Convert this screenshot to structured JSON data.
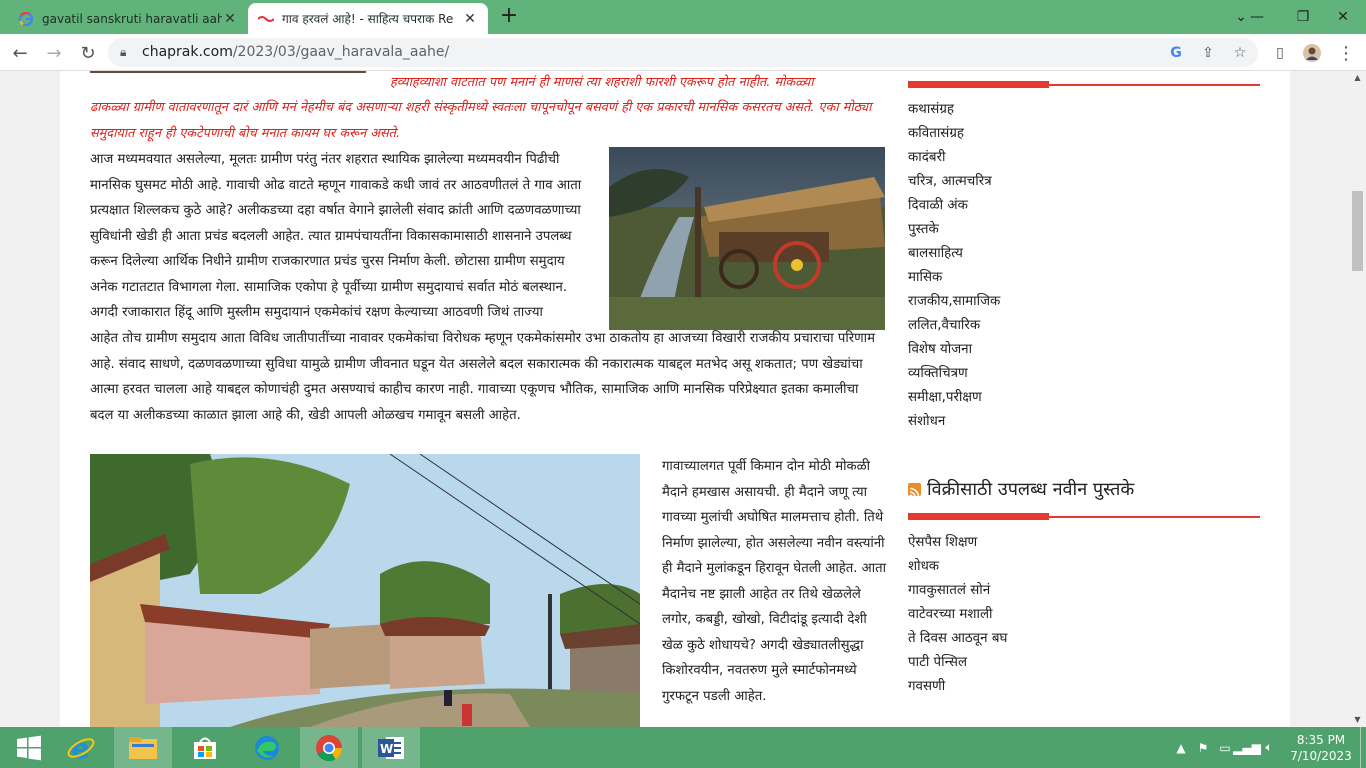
{
  "browser": {
    "tabs": [
      {
        "title": "gavatil sanskruti haravatli aahe in",
        "icon": "google-icon"
      },
      {
        "title": "गाव हरवलं आहे! - साहित्य चपराक Re",
        "icon": "chaprak-icon"
      }
    ],
    "url_domain": "chaprak.com",
    "url_path": "/2023/03/gaav_haravala_aahe/"
  },
  "article": {
    "quote_line1": "हव्याहव्याशा वाटतात पण मनानं ही माणसं त्या शहराशी फारशी एकरूप होत नाहीत. मोकळ्या",
    "quote_line2": "ढाकळ्या ग्रामीण वातावरणातून दारं आणि मनं नेहमीच बंद असणाऱ्या शहरी संस्कृतीमध्ये स्वतःला चापूनचोपून बसवणं ही एक प्रकारची मानसिक कसरतच असते. एका मोठ्या समुदायात राहून ही एकटेपणाची बोच मनात कायम घर करून असते.",
    "para1": "आज मध्यमवयात असलेल्या, मूलतः ग्रामीण परंतु नंतर शहरात स्थायिक झालेल्या मध्यमवयीन पिढीची मानसिक घुसमट मोठी आहे. गावाची ओढ वाटते म्हणून गावाकडे कधी जावं तर आठवणीतलं ते गाव आता प्रत्यक्षात शिल्लकच कुठे आहे? अलीकडच्या दहा वर्षात वेगाने झालेली संवाद क्रांती आणि दळणवळणाच्या सुविधांनी खेडी ही आता प्रचंड बदलली आहेत. त्यात ग्रामपंचायतींना विकासकामासाठी शासनाने उपलब्ध करून दिलेल्या आर्थिक निधीने ग्रामीण राजकारणात प्रचंड चुरस निर्माण केली. छोटासा ग्रामीण समुदाय अनेक गटातटात विभागला गेला. सामाजिक एकोपा हे पूर्वीच्या ग्रामीण समुदायाचं सर्वात मोठं बलस्थान. अगदी रजाकारात हिंदू आणि मुस्लीम समुदायानं एकमेकांचं रक्षण केल्याच्या आठवणी जिथं ताज्या",
    "para1b": "आहेत तोच ग्रामीण समुदाय आता विविध जातीपातींच्या नावावर एकमेकांचा विरोधक म्हणून एकमेकांसमोर उभा ठाकतोय हा आजच्या विखारी राजकीय प्रचाराचा परिणाम आहे. संवाद साधणे, दळणवळणाच्या सुविधा यामुळे ग्रामीण जीवनात घडून येत असलेले बदल सकारात्मक की नकारात्मक याबद्दल मतभेद असू शकतात; पण खेड्यांचा आत्मा हरवत चालला आहे याबद्दल कोणाचंही दुमत असण्याचं काहीच कारण नाही. गावाच्या एकूणच भौतिक, सामाजिक आणि मानसिक परिप्रेक्ष्यात इतका कमालीचा बदल या अलीकडच्या काळात झाला आहे की, खेडी आपली ओळखच गमावून बसली आहेत.",
    "para2": "गावाच्यालगत पूर्वी किमान दोन मोठी मोकळी मैदाने हमखास असायची. ही मैदाने जणू त्या गावच्या मुलांची अघोषित मालमत्ताच होती. तिथे निर्माण झालेल्या, होत असलेल्या नवीन वस्त्यांनी ही मैदाने मुलांकडून हिरावून घेतली आहेत. आता मैदानेच नष्ट झाली आहेत तर तिथे खेळलेले लगोर, कबड्डी, खोखो, विटीदांडू इत्यादी देशी खेळ कुठे शोधायचे? अगदी खेड्यातलीसुद्धा किशोरवयीन, नवतरुण मुले स्मार्टफोनमध्ये गुरफटून पडली आहेत."
  },
  "sidebar": {
    "categories": [
      "कथासंग्रह",
      "कवितासंग्रह",
      "कादंबरी",
      "चरित्र, आत्मचरित्र",
      "दिवाळी अंक",
      "पुस्तके",
      "बालसाहित्य",
      "मासिक",
      "राजकीय,सामाजिक",
      "ललित,वैचारिक",
      "विशेष योजना",
      "व्यक्तिचित्रण",
      "समीक्षा,परीक्षण",
      "संशोधन"
    ],
    "books_heading": "विक्रीसाठी उपलब्ध नवीन पुस्तके",
    "books": [
      "ऐसपैस शिक्षण",
      "शोधक",
      "गावकुसातलं सोनं",
      "वाटेवरच्या मशाली",
      "ते दिवस आठवून बघ",
      "पाटी पेन्सिल",
      "गवसणी"
    ],
    "accent": "#e63a2e"
  },
  "taskbar": {
    "time": "8:35 PM",
    "date": "7/10/2023",
    "apps": [
      "start-icon",
      "ie-icon",
      "file-explorer-icon",
      "store-icon",
      "edge-icon",
      "chrome-icon",
      "word-icon"
    ]
  }
}
